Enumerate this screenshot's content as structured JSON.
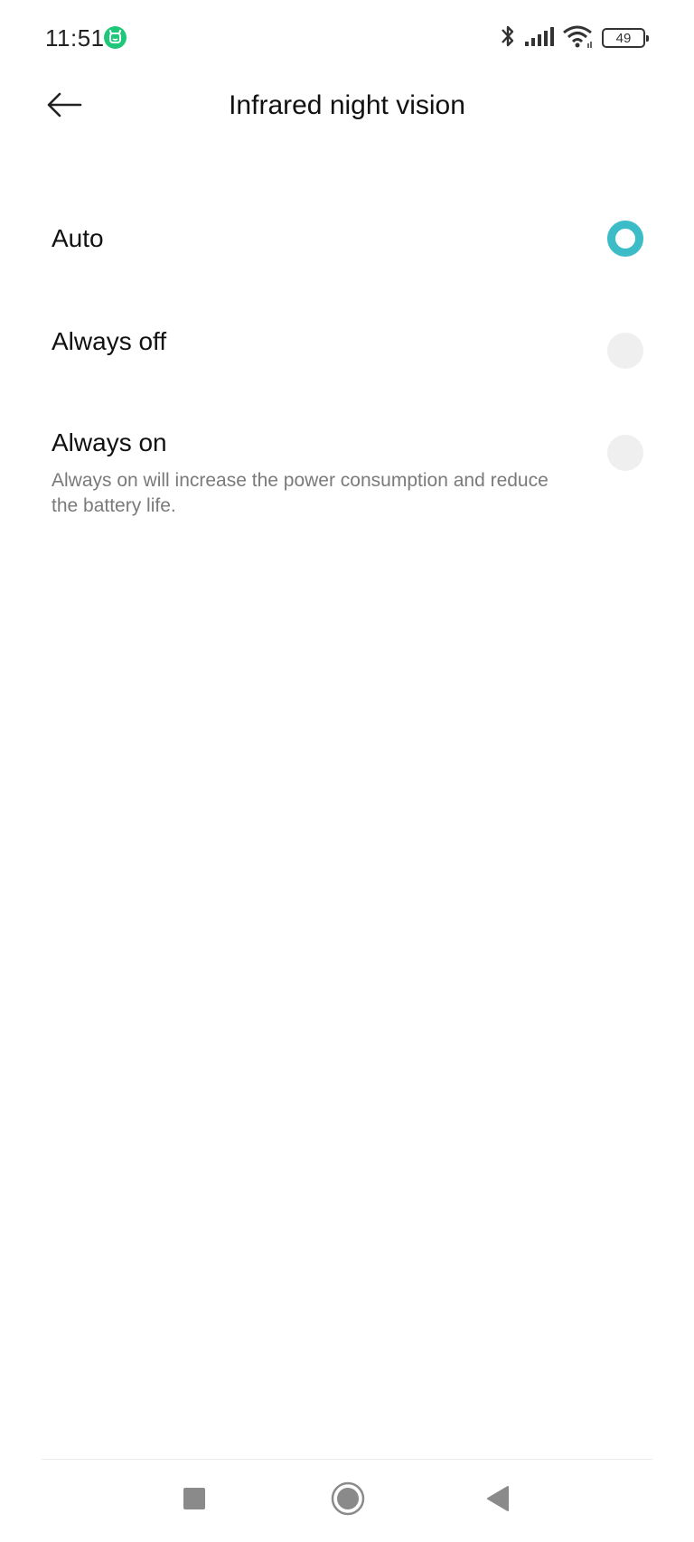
{
  "status_bar": {
    "time": "11:51",
    "battery_level": "49",
    "app_badge_color": "#1ec779",
    "icons": [
      "bluetooth-icon",
      "signal-icon",
      "wifi-icon",
      "battery-icon"
    ]
  },
  "header": {
    "title": "Infrared night vision",
    "back_icon": "arrow-left-icon"
  },
  "options": [
    {
      "label": "Auto",
      "description": "",
      "selected": true
    },
    {
      "label": "Always off",
      "description": "",
      "selected": false
    },
    {
      "label": "Always on",
      "description": "Always on will increase the power consumption and reduce the battery life.",
      "selected": false
    }
  ],
  "colors": {
    "accent": "#3cbcc7",
    "radio_unselected": "#efefef",
    "description_text": "#7a7a7a"
  },
  "nav_bar": {
    "icons": [
      "recents-square-icon",
      "home-circle-icon",
      "back-triangle-icon"
    ]
  }
}
